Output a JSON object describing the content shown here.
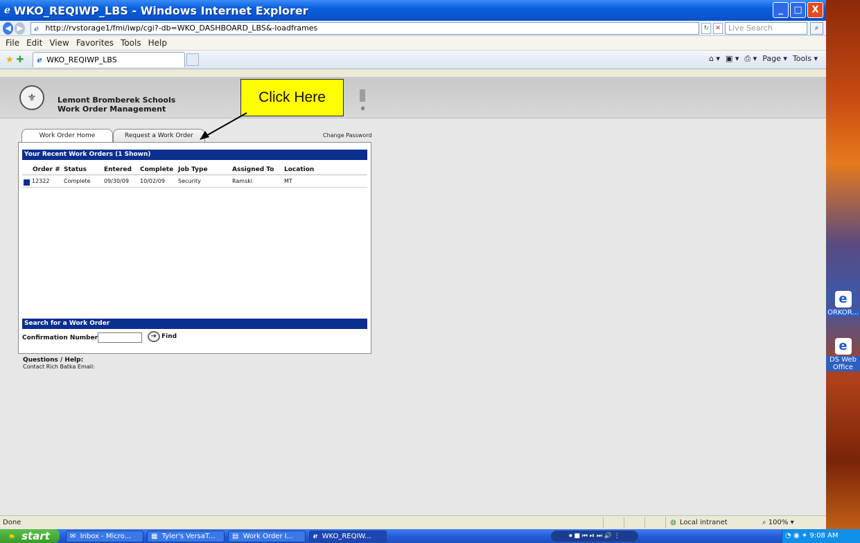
{
  "window": {
    "title": "WKO_REQIWP_LBS - Windows Internet Explorer",
    "controls": {
      "minimize": "_",
      "maximize": "□",
      "close": "X"
    }
  },
  "address": {
    "url": "http://rvstorage1/fmi/iwp/cgi?-db=WKO_DASHBOARD_LBS&-loadframes",
    "live_search_placeholder": "Live Search"
  },
  "menu": [
    "File",
    "Edit",
    "View",
    "Favorites",
    "Tools",
    "Help"
  ],
  "browser_tab": {
    "label": "WKO_REQIWP_LBS"
  },
  "command_bar": {
    "page": "Page ▾",
    "tools": "Tools ▾"
  },
  "header": {
    "school_name": "Lemont Bromberek Schools",
    "subtitle": "Work Order Management",
    "partial_text": "e"
  },
  "tabs": {
    "home": "Work Order Home",
    "request": "Request a Work Order",
    "change_password": "Change Password"
  },
  "recent": {
    "title": "Your Recent Work Orders (1 Shown)",
    "columns": [
      "Order #",
      "Status",
      "Entered",
      "Complete",
      "Job Type",
      "Assigned To",
      "Location"
    ],
    "rows": [
      {
        "order": "12322",
        "status": "Complete",
        "entered": "09/30/09",
        "complete": "10/02/09",
        "job_type": "Security",
        "assigned_to": "Ramski",
        "location": "MT"
      }
    ]
  },
  "search": {
    "title": "Search for a Work Order",
    "label": "Confirmation Number",
    "value": "",
    "find_label": "Find"
  },
  "help": {
    "title": "Questions / Help:",
    "contact": "Contact Rich Batka Email:"
  },
  "callout": {
    "text": "Click Here"
  },
  "status_bar": {
    "left": "Done",
    "zone": "Local intranet",
    "zoom": "100%"
  },
  "taskbar": {
    "start": "start",
    "tasks": [
      "Inbox - Micro...",
      "Tyler's VersaT...",
      "Work Order I...",
      "WKO_REQIW..."
    ],
    "clock": "9:08 AM"
  },
  "desktop_icons": [
    "ORKOR...",
    "DS Web Office"
  ]
}
